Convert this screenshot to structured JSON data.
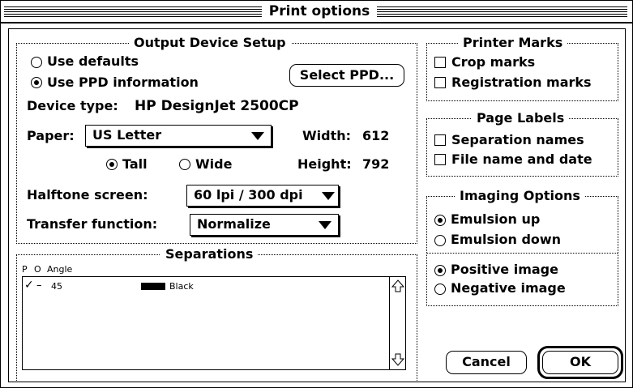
{
  "window": {
    "title": "Print options"
  },
  "output_device": {
    "legend": "Output Device Setup",
    "use_defaults": "Use defaults",
    "use_ppd": "Use PPD information",
    "select_ppd_button": "Select PPD...",
    "device_type_label": "Device type:",
    "device_type_value": "HP DesignJet 2500CP",
    "paper_label": "Paper:",
    "paper_value": "US Letter",
    "width_label": "Width:",
    "width_value": "612",
    "height_label": "Height:",
    "height_value": "792",
    "tall": "Tall",
    "wide": "Wide",
    "halftone_label": "Halftone screen:",
    "halftone_value": "60 lpi / 300 dpi",
    "transfer_label": "Transfer function:",
    "transfer_value": "Normalize"
  },
  "separations": {
    "legend": "Separations",
    "col_p": "P",
    "col_o": "O",
    "col_angle": "Angle",
    "rows": [
      {
        "p": "✓",
        "o": "–",
        "angle": "45",
        "color_name": "Black",
        "swatch": "#000000"
      }
    ]
  },
  "printer_marks": {
    "legend": "Printer Marks",
    "crop": "Crop marks",
    "registration": "Registration marks"
  },
  "page_labels": {
    "legend": "Page Labels",
    "separation_names": "Separation names",
    "file_name_date": "File name and date"
  },
  "imaging": {
    "legend": "Imaging Options",
    "emulsion_up": "Emulsion up",
    "emulsion_down": "Emulsion down",
    "positive": "Positive image",
    "negative": "Negative image"
  },
  "buttons": {
    "cancel": "Cancel",
    "ok": "OK"
  }
}
